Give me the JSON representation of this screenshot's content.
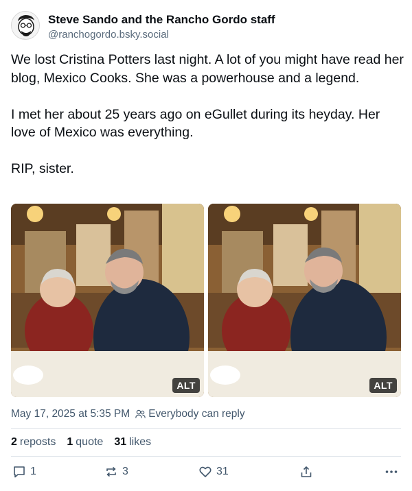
{
  "author": {
    "display_name": "Steve Sando and the Rancho Gordo staff",
    "handle": "@ranchogordo.bsky.social",
    "avatar_icon": "caricature-avatar"
  },
  "post": {
    "paragraphs": [
      "We lost Cristina Potters last night. A lot of you might have read her blog, Mexico Cooks. She was a powerhouse and a legend.",
      "I met her about 25 years ago on eGullet during its heyday. Her love of Mexico was everything.",
      "RIP, sister."
    ],
    "images": [
      {
        "alt_badge": "ALT"
      },
      {
        "alt_badge": "ALT"
      }
    ]
  },
  "meta": {
    "timestamp": "May 17, 2025 at 5:35 PM",
    "reply_setting": "Everybody can reply",
    "reply_icon": "people-icon"
  },
  "stats": {
    "reposts_count": "2",
    "reposts_label": "reposts",
    "quotes_count": "1",
    "quotes_label": "quote",
    "likes_count": "31",
    "likes_label": "likes"
  },
  "actions": {
    "reply_count": "1",
    "repost_count": "3",
    "like_count": "31"
  },
  "colors": {
    "text": "#0b0f14",
    "muted": "#42576c",
    "divider": "#e1e6eb"
  }
}
